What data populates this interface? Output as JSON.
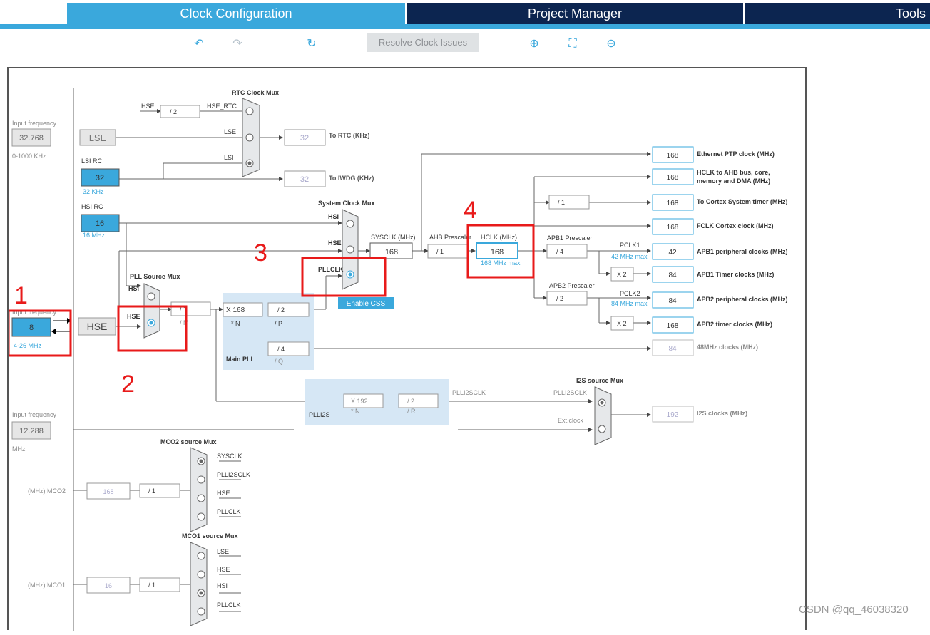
{
  "tabs": [
    "Clock Configuration",
    "Project Manager",
    "Tools"
  ],
  "toolbar": {
    "undo_icon": "undo-icon",
    "redo_icon": "redo-icon",
    "refresh_icon": "refresh-icon",
    "resolve_label": "Resolve Clock Issues",
    "zoom_in_icon": "zoom-in-icon",
    "fit_icon": "fit-screen-icon",
    "zoom_out_icon": "zoom-out-icon"
  },
  "annotations": [
    "1",
    "2",
    "3",
    "4"
  ],
  "watermark": "CSDN @qq_46038320",
  "diagram": {
    "lse_input": {
      "caption": "Input frequency",
      "value": "32.768",
      "range": "0-1000 KHz",
      "block": "LSE"
    },
    "lsi": {
      "label": "LSI RC",
      "value": "32",
      "unit": "32 KHz"
    },
    "hsi": {
      "label": "HSI RC",
      "value": "16",
      "unit": "16 MHz"
    },
    "hse_input": {
      "caption": "Input frequency",
      "value": "8",
      "range": "4-26 MHz",
      "block": "HSE"
    },
    "i2s_input": {
      "caption": "Input frequency",
      "value": "12.288",
      "unit": "MHz"
    },
    "rtc_mux": {
      "title": "RTC Clock Mux",
      "hse": "HSE",
      "div": "/ 2",
      "hse_rtc": "HSE_RTC",
      "lse": "LSE",
      "lsi": "LSI",
      "out": "32",
      "out_label": "To RTC (KHz)"
    },
    "iwdg": {
      "out": "32",
      "label": "To IWDG (KHz)"
    },
    "pll_source": {
      "title": "PLL Source Mux",
      "hsi": "HSI",
      "hse": "HSE",
      "m": "/ 1",
      "m_label": "/ M"
    },
    "main_pll": {
      "title": "Main PLL",
      "n": "X 168",
      "n_label": "* N",
      "p": "/ 2",
      "p_label": "/ P",
      "q": "/ 4",
      "q_label": "/ Q"
    },
    "sys_mux": {
      "title": "System Clock Mux",
      "hsi": "HSI",
      "hse": "HSE",
      "pllclk": "PLLCLK",
      "css": "Enable CSS"
    },
    "sysclk": {
      "label": "SYSCLK (MHz)",
      "value": "168"
    },
    "ahb": {
      "label": "AHB Prescaler",
      "value": "/ 1"
    },
    "hclk": {
      "label": "HCLK (MHz)",
      "value": "168",
      "max": "168 MHz max"
    },
    "apb1": {
      "label": "APB1 Prescaler",
      "value": "/ 4",
      "pclk": "PCLK1",
      "max": "42 MHz max",
      "x2": "X 2"
    },
    "apb2": {
      "label": "APB2 Prescaler",
      "value": "/ 2",
      "pclk": "PCLK2",
      "max": "84 MHz max",
      "x2": "X 2"
    },
    "cortex_div": "/ 1",
    "outputs": [
      {
        "value": "168",
        "label": "Ethernet PTP clock (MHz)"
      },
      {
        "value": "168",
        "label": "HCLK to AHB bus, core,",
        "label2": "memory and DMA (MHz)"
      },
      {
        "value": "168",
        "label": "To Cortex System timer (MHz)"
      },
      {
        "value": "168",
        "label": "FCLK Cortex clock (MHz)"
      },
      {
        "value": "42",
        "label": "APB1 peripheral clocks (MHz)"
      },
      {
        "value": "84",
        "label": "APB1 Timer clocks (MHz)"
      },
      {
        "value": "84",
        "label": "APB2 peripheral clocks (MHz)"
      },
      {
        "value": "168",
        "label": "APB2 timer clocks (MHz)"
      },
      {
        "value": "84",
        "label": "48MHz clocks (MHz)"
      },
      {
        "value": "192",
        "label": "I2S clocks (MHz)"
      }
    ],
    "plli2s": {
      "title": "PLLI2S",
      "n": "X 192",
      "n_label": "* N",
      "r": "/ 2",
      "r_label": "/ R",
      "out": "PLLI2SCLK"
    },
    "i2s_mux": {
      "title": "I2S source Mux",
      "plli2sclk": "PLLI2SCLK",
      "ext": "Ext.clock"
    },
    "mco2": {
      "title": "MCO2 source Mux",
      "in": [
        "SYSCLK",
        "PLLI2SCLK",
        "HSE",
        "PLLCLK"
      ],
      "div": "/ 1",
      "out": "168",
      "label": "(MHz) MCO2"
    },
    "mco1": {
      "title": "MCO1 source Mux",
      "in": [
        "LSE",
        "HSE",
        "HSI",
        "PLLCLK"
      ],
      "div": "/ 1",
      "out": "16",
      "label": "(MHz) MCO1"
    }
  }
}
